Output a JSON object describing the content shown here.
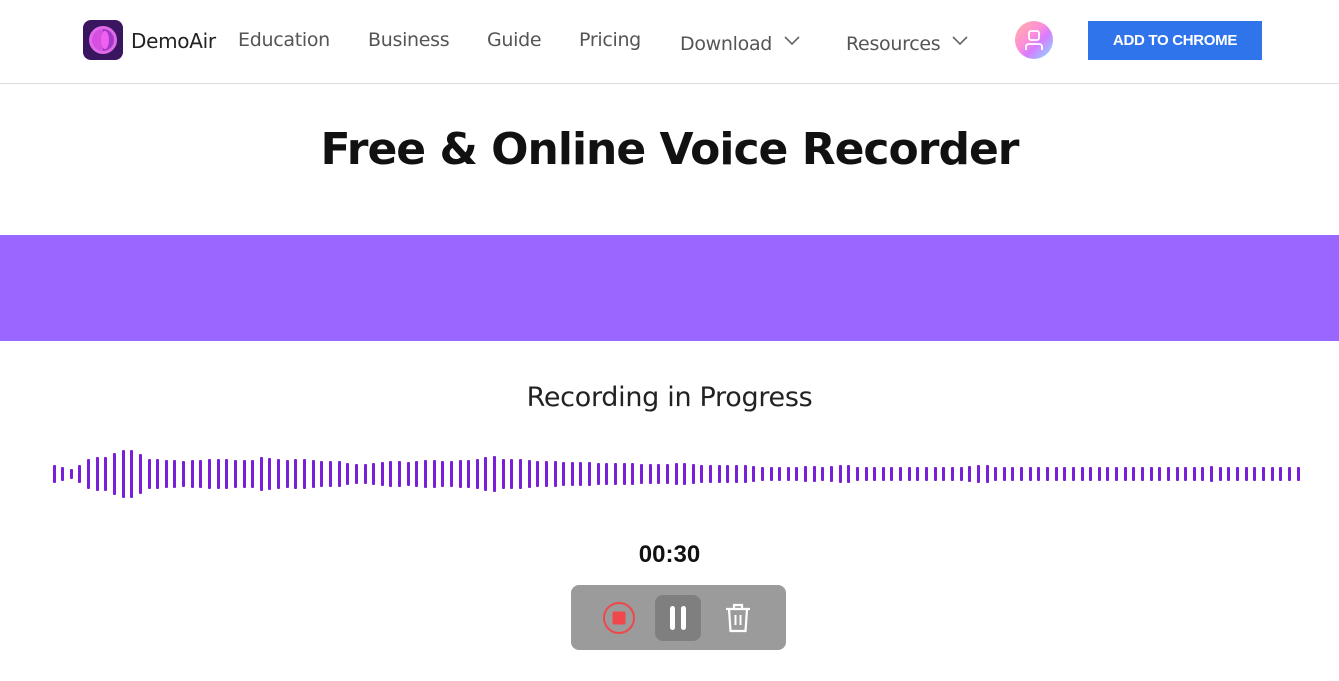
{
  "nav": {
    "brand": "DemoAir",
    "items": [
      {
        "label": "Education",
        "has_dropdown": false
      },
      {
        "label": "Business",
        "has_dropdown": false
      },
      {
        "label": "Guide",
        "has_dropdown": false
      },
      {
        "label": "Pricing",
        "has_dropdown": false
      },
      {
        "label": "Download",
        "has_dropdown": true
      },
      {
        "label": "Resources",
        "has_dropdown": true
      }
    ],
    "avatar_icon": "user-icon",
    "cta_label": "ADD TO CHROME"
  },
  "colors": {
    "brand_primary": "#2f74eb",
    "banner": "#9966ff",
    "waveform": "#7a1fd8",
    "stop_icon": "#f0474b",
    "controls_bg": "#9b9b9b"
  },
  "page": {
    "title": "Free & Online Voice Recorder",
    "status": "Recording in Progress",
    "timer": "00:30"
  },
  "controls": [
    {
      "name": "stop",
      "icon": "stop-record-icon"
    },
    {
      "name": "pause",
      "icon": "pause-icon"
    },
    {
      "name": "delete",
      "icon": "trash-icon"
    }
  ],
  "waveform": {
    "amplitudes": [
      0.36,
      0.29,
      0.21,
      0.39,
      0.61,
      0.71,
      0.71,
      0.86,
      1.0,
      1.0,
      0.82,
      0.64,
      0.61,
      0.57,
      0.57,
      0.54,
      0.57,
      0.57,
      0.61,
      0.64,
      0.61,
      0.57,
      0.57,
      0.57,
      0.71,
      0.68,
      0.61,
      0.57,
      0.64,
      0.61,
      0.57,
      0.54,
      0.54,
      0.54,
      0.46,
      0.43,
      0.43,
      0.46,
      0.5,
      0.54,
      0.54,
      0.5,
      0.54,
      0.57,
      0.57,
      0.54,
      0.54,
      0.57,
      0.57,
      0.61,
      0.71,
      0.75,
      0.64,
      0.61,
      0.61,
      0.57,
      0.54,
      0.54,
      0.54,
      0.5,
      0.5,
      0.5,
      0.5,
      0.46,
      0.46,
      0.46,
      0.46,
      0.46,
      0.43,
      0.43,
      0.43,
      0.43,
      0.46,
      0.46,
      0.43,
      0.39,
      0.36,
      0.36,
      0.36,
      0.39,
      0.39,
      0.32,
      0.29,
      0.29,
      0.29,
      0.29,
      0.29,
      0.32,
      0.32,
      0.29,
      0.32,
      0.36,
      0.36,
      0.29,
      0.29,
      0.29,
      0.29,
      0.29,
      0.29,
      0.29,
      0.29,
      0.29,
      0.29,
      0.29,
      0.29,
      0.29,
      0.32,
      0.36,
      0.36,
      0.29,
      0.29,
      0.29,
      0.29,
      0.29,
      0.29,
      0.29,
      0.29,
      0.29,
      0.29,
      0.29,
      0.29,
      0.29,
      0.29,
      0.29,
      0.29,
      0.29,
      0.29,
      0.29,
      0.29,
      0.29,
      0.29,
      0.29,
      0.29,
      0.29,
      0.32,
      0.29,
      0.29,
      0.29,
      0.29,
      0.29,
      0.29,
      0.29,
      0.29,
      0.29,
      0.29
    ]
  }
}
